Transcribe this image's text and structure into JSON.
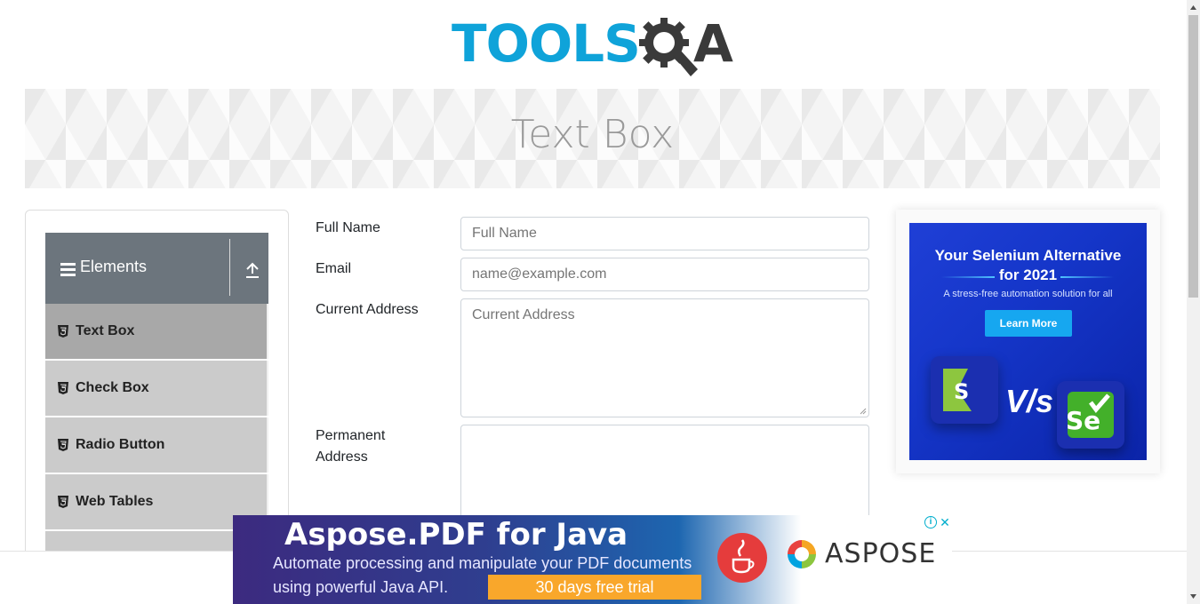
{
  "logo": {
    "text": "TOOLS",
    "suffix": "A"
  },
  "banner": {
    "title": "Text Box"
  },
  "sidebar": {
    "group": {
      "label": "Elements",
      "icon": "hamburger-icon",
      "toggle_icon": "collapse-up-icon"
    },
    "items": [
      {
        "label": "Text Box",
        "active": true
      },
      {
        "label": "Check Box",
        "active": false
      },
      {
        "label": "Radio Button",
        "active": false
      },
      {
        "label": "Web Tables",
        "active": false
      }
    ]
  },
  "form": {
    "full_name": {
      "label": "Full Name",
      "placeholder": "Full Name",
      "value": ""
    },
    "email": {
      "label": "Email",
      "placeholder": "name@example.com",
      "value": ""
    },
    "current_address": {
      "label": "Current Address",
      "placeholder": "Current Address",
      "value": ""
    },
    "permanent_address": {
      "label_line1": "Permanent",
      "label_line2": "Address",
      "value": ""
    }
  },
  "side_ad": {
    "title_line1": "Your Selenium Alternative",
    "title_line2": "for 2021",
    "subtitle": "A stress-free automation solution for all",
    "button": "Learn More",
    "vs": "V/s",
    "selenium_label": "Se"
  },
  "bottom_ad": {
    "title": "Aspose.PDF for Java",
    "line1": "Automate processing and manipulate your PDF documents",
    "line2": "using powerful Java API.",
    "cta": "30 days free trial",
    "brand": "ASPOSE",
    "info": "i",
    "close": "✕"
  },
  "colors": {
    "logo_blue": "#0fa3d9",
    "logo_dark": "#3a3a3a",
    "group_header": "#6c757d",
    "menu_item": "#cbcbcb",
    "menu_item_active": "#a8a8a8",
    "ad_blue": "#1536c9",
    "cta_orange": "#f9a72b"
  }
}
